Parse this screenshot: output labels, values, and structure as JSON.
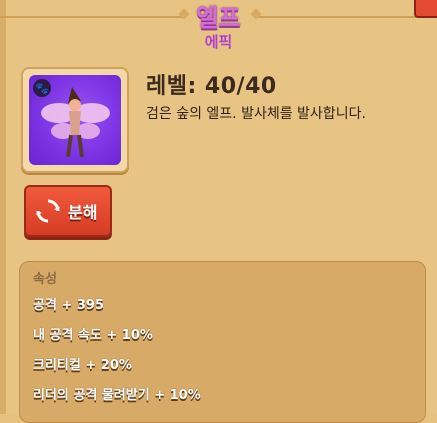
{
  "header": {
    "title": "엘프",
    "rarity": "에픽"
  },
  "item": {
    "type_icon": "paw-icon",
    "level_text": "레벨: 40/40",
    "description": "검은 숲의 엘프. 발사체를 발사합니다."
  },
  "actions": {
    "disassemble_label": "분해"
  },
  "attributes": {
    "section_title": "속성",
    "lines": [
      "공격 + 395",
      "내 공격 속도 + 10%",
      "크리티컬 + 20%",
      "리더의 공격 물려받기 + 10%"
    ]
  },
  "colors": {
    "panel": "#e7c483",
    "title": "#d66bd9",
    "rarity": "#b03fd1",
    "button": "#e34a2f",
    "card_bg": "#7d34e4"
  }
}
